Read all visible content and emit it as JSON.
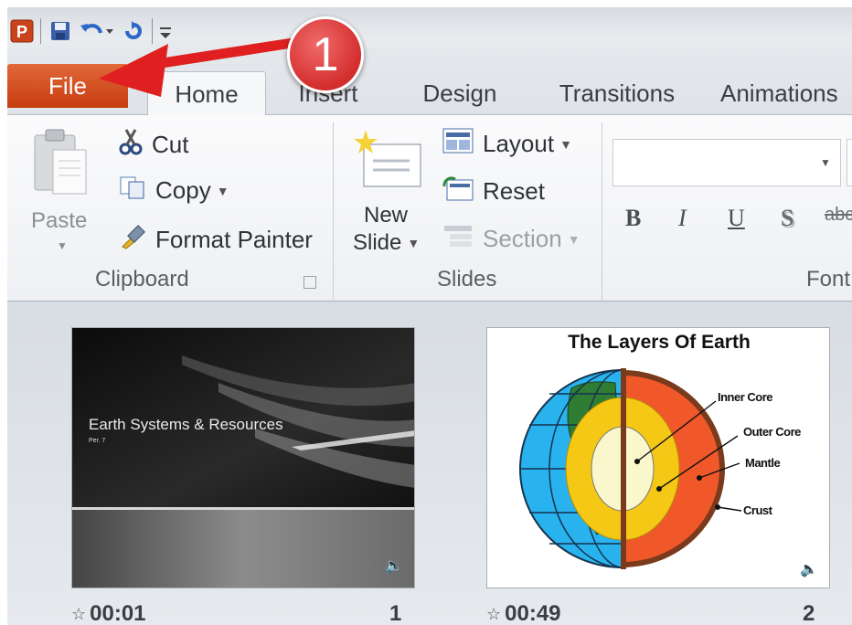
{
  "tabs": {
    "file": "File",
    "home": "Home",
    "insert": "Insert",
    "design": "Design",
    "transitions": "Transitions",
    "animations": "Animations"
  },
  "clipboard": {
    "paste": "Paste",
    "cut": "Cut",
    "copy": "Copy",
    "format_painter": "Format Painter",
    "group_label": "Clipboard"
  },
  "slides_group": {
    "new_slide_line1": "New",
    "new_slide_line2": "Slide",
    "layout": "Layout",
    "reset": "Reset",
    "section": "Section",
    "group_label": "Slides"
  },
  "font_group": {
    "bold": "B",
    "italic": "I",
    "underline": "U",
    "shadow": "S",
    "strikethrough": "abc",
    "group_label": "Font"
  },
  "callout": {
    "number": "1"
  },
  "slides": [
    {
      "title": "Earth Systems & Resources",
      "subtitle": "Per. 7",
      "time": "00:01",
      "number": "1"
    },
    {
      "title": "The Layers Of Earth",
      "labels": [
        "Inner Core",
        "Outer Core",
        "Mantle",
        "Crust"
      ],
      "time": "00:49",
      "number": "2"
    }
  ],
  "colors": {
    "file_tab": "#d5501e",
    "callout": "#d93636",
    "arrow": "#e02020"
  }
}
